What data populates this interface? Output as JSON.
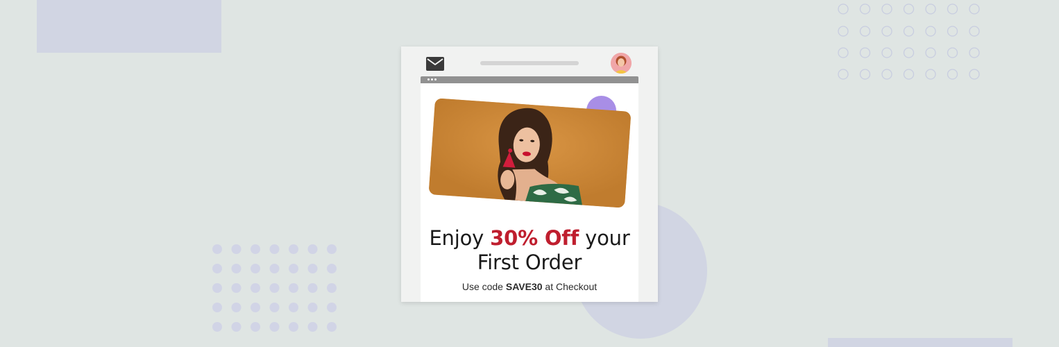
{
  "promo": {
    "headline_pre": "Enjoy ",
    "headline_accent": "30% Off",
    "headline_post": " your",
    "headline_line2": "First Order",
    "code_pre": "Use code ",
    "code": "SAVE30",
    "code_post": " at Checkout"
  },
  "icons": {
    "mail": "mail-icon",
    "avatar": "avatar"
  },
  "colors": {
    "background": "#dfe5e3",
    "accent_red": "#bf1e2e",
    "decoration_lavender": "#d1d5e3",
    "blob_purple": "#a88ee6",
    "hero_orange": "#cc8a37"
  }
}
